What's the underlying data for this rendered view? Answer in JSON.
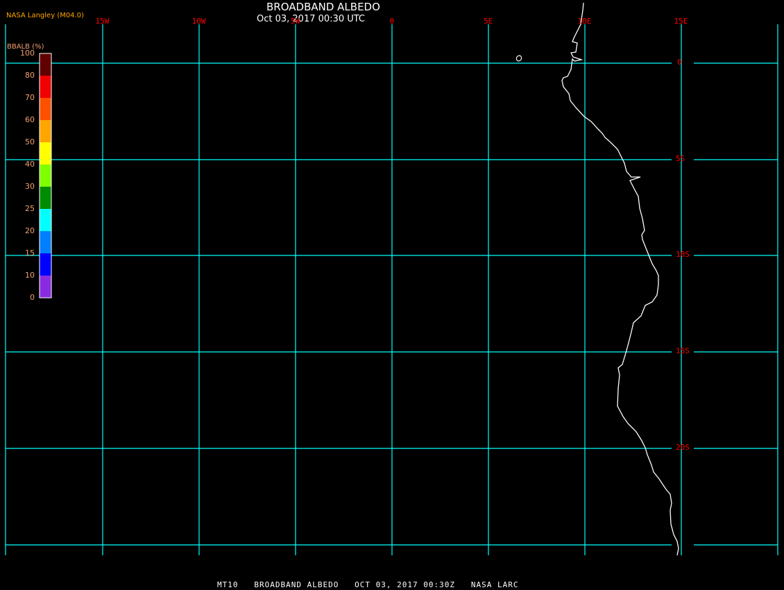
{
  "header": {
    "title": "BROADBAND ALBEDO",
    "subtitle": "Oct 03, 2017 00:30 UTC",
    "credit": "NASA Langley (M04.0)"
  },
  "footer": "MT10   BROADBAND ALBEDO   OCT 03, 2017 00:30Z   NASA LARC",
  "colorbar": {
    "title": "BBALB (%)",
    "labels": [
      "100",
      "80",
      "70",
      "60",
      "50",
      "40",
      "30",
      "25",
      "20",
      "15",
      "10",
      "0"
    ],
    "colors": [
      "#600000",
      "#f00000",
      "#ff5000",
      "#ffa500",
      "#ffff00",
      "#80ff00",
      "#008c00",
      "#00ffff",
      "#0080ff",
      "#0000ff",
      "#8a2be2"
    ]
  },
  "map": {
    "longitude_labels": [
      "15W",
      "10W",
      "5W",
      "0",
      "5E",
      "10E",
      "15E"
    ],
    "latitude_labels": [
      "0",
      "5S",
      "10S",
      "15S",
      "20S"
    ],
    "grid_color": "#00ffff",
    "label_color": "#ff0000",
    "coastline_color": "#ffffff"
  }
}
